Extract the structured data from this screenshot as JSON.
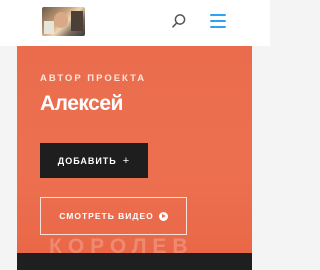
{
  "header": {
    "logo_name": "logo-photo",
    "search_icon": "search-icon",
    "menu_icon": "hamburger-menu-icon",
    "accent_color": "#2ea3f2"
  },
  "hero": {
    "label": "АВТОР ПРОЕКТА",
    "name": "Алексей",
    "add_button": "ДОБАВИТЬ",
    "add_icon": "+",
    "video_button": "СМОТРЕТЬ ВИДЕО",
    "watermark": "КОРОЛЕВ",
    "background_color": "#ea6c4d"
  }
}
